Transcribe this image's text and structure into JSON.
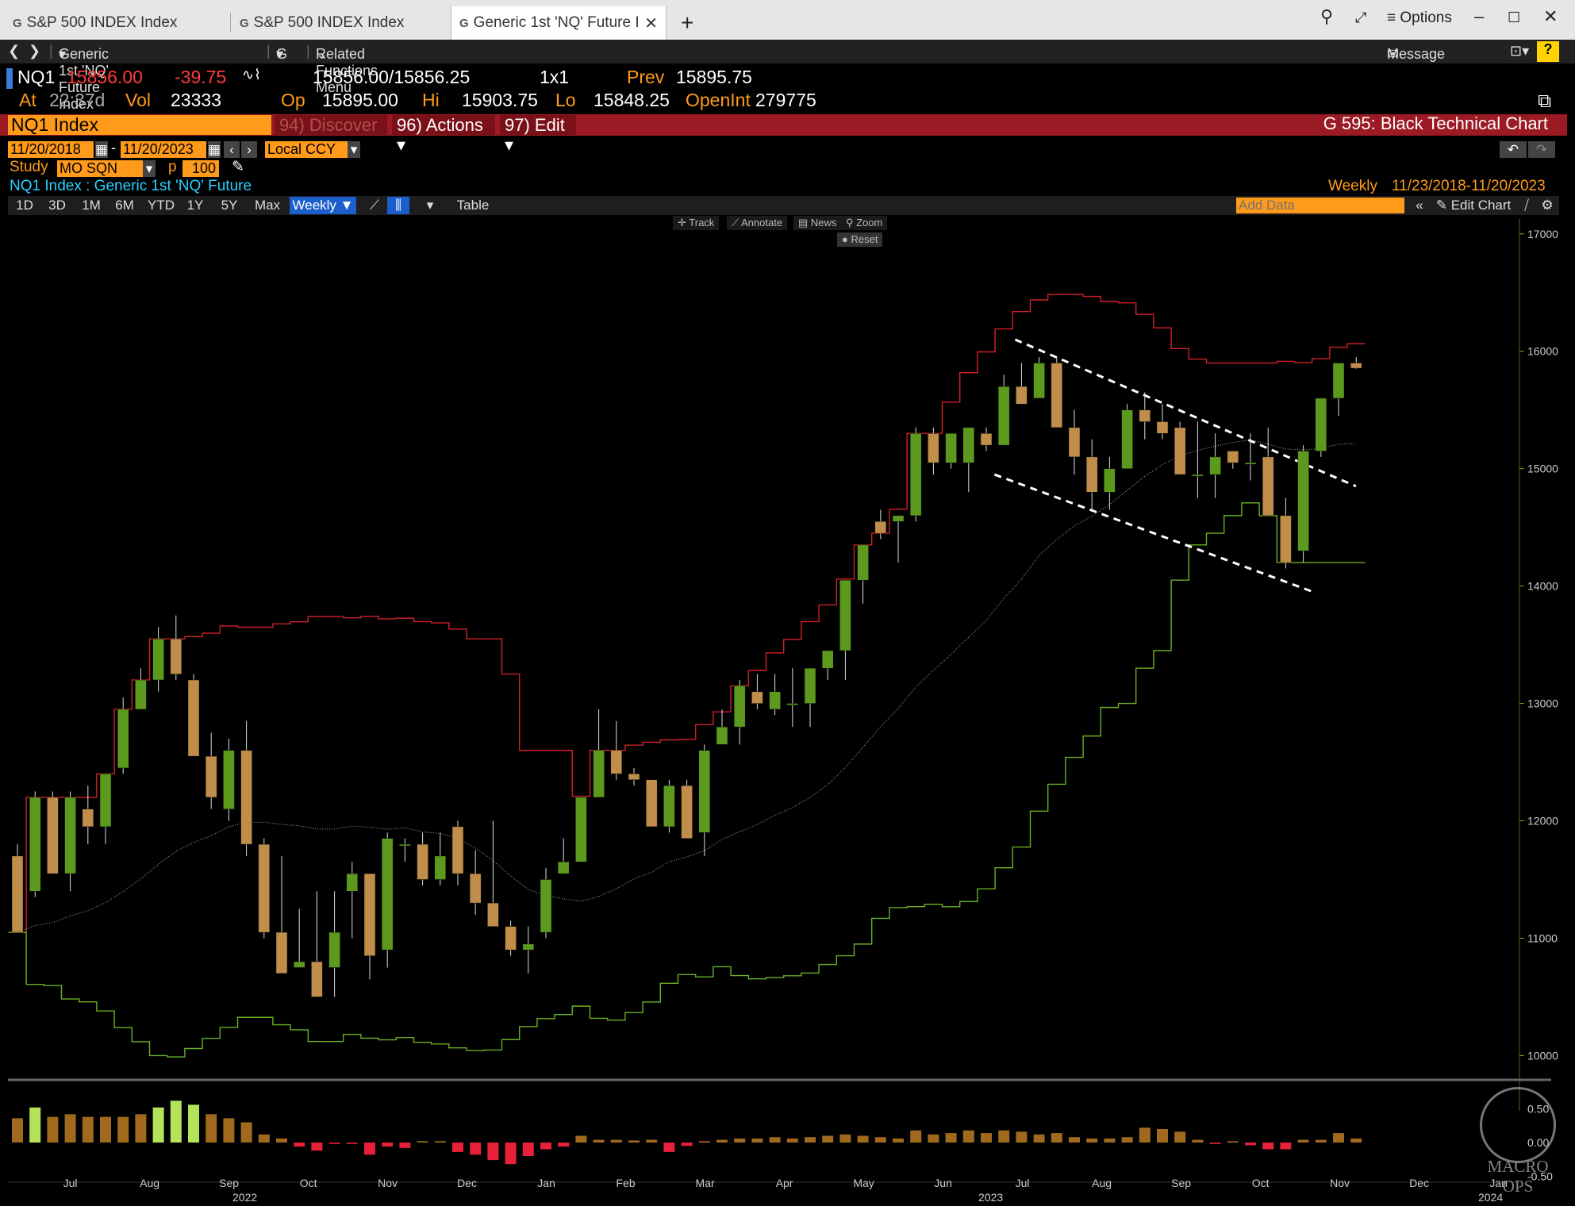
{
  "tabs": [
    {
      "icon": "G",
      "label": "S&P 500 INDEX Index"
    },
    {
      "icon": "G",
      "label": "S&P 500 INDEX Index"
    },
    {
      "icon": "G",
      "label": "Generic 1st 'NQ' Future Ind"
    }
  ],
  "window": {
    "options_label": "Options"
  },
  "nav": {
    "security_menu": "Generic 1st 'NQ' Future Index",
    "g_menu": "G",
    "related": "Related Functions Menu",
    "message": "Message",
    "help": "?"
  },
  "quote": {
    "ticker": "NQ1",
    "last": "15856.00",
    "change": "-39.75",
    "bidask": "15856.00/15856.25",
    "size": "1x1",
    "prev_label": "Prev",
    "prev": "15895.75",
    "at_label": "At",
    "time": "22:37d",
    "vol_label": "Vol",
    "vol": "23333",
    "op_label": "Op",
    "open": "15895.00",
    "hi_label": "Hi",
    "high": "15903.75",
    "lo_label": "Lo",
    "low": "15848.25",
    "oi_label": "OpenInt",
    "open_interest": "279775"
  },
  "command": {
    "security": "NQ1 Index",
    "discover": "94) Discover",
    "actions": "96) Actions",
    "edit": "97) Edit",
    "function_title": "G 595: Black Technical Chart"
  },
  "controls": {
    "start_date": "11/20/2018",
    "end_date": "11/20/2023",
    "dash": "-",
    "currency": "Local CCY",
    "study_label": "Study",
    "study": "MO SQN",
    "p_label": "p",
    "p_value": "100",
    "security_desc": "NQ1 Index : Generic 1st 'NQ' Future",
    "period": "Weekly",
    "range": "11/23/2018-11/20/2023",
    "add_data_placeholder": "Add Data",
    "edit_chart": "Edit Chart"
  },
  "timeframes": [
    "1D",
    "3D",
    "1M",
    "6M",
    "YTD",
    "1Y",
    "5Y",
    "Max"
  ],
  "selected_timeframe": "Weekly",
  "table_label": "Table",
  "chart_tools": [
    "Track",
    "Annotate",
    "News",
    "Zoom"
  ],
  "reset_label": "Reset",
  "watermark": "MACRO OPS",
  "colors": {
    "up": "#5b9a1c",
    "down": "#c08d4a",
    "upper_band": "#d0202a",
    "lower_band": "#6ab023",
    "hist_pos": "#a0691e",
    "hist_neg": "#e8203a",
    "hist_hi": "#b4e35a",
    "accent": "#ff9a1a"
  },
  "chart_data": {
    "type": "candlestick",
    "period": "weekly",
    "ylim": [
      9800,
      17100
    ],
    "yticks": [
      10000,
      11000,
      12000,
      13000,
      14000,
      15000,
      16000,
      17000
    ],
    "x_month_labels": [
      "Jul",
      "Aug",
      "Sep",
      "Oct",
      "Nov",
      "Dec",
      "Jan",
      "Feb",
      "Mar",
      "Apr",
      "May",
      "Jun",
      "Jul",
      "Aug",
      "Sep",
      "Oct",
      "Nov",
      "Dec",
      "Jan"
    ],
    "x_year_labels": [
      "2022",
      "2023",
      "2024"
    ],
    "candles": [
      {
        "o": 11700,
        "h": 11800,
        "l": 11050,
        "c": 11050
      },
      {
        "o": 11400,
        "h": 12250,
        "l": 11350,
        "c": 12200
      },
      {
        "o": 12200,
        "h": 12250,
        "l": 11550,
        "c": 11550
      },
      {
        "o": 11550,
        "h": 12250,
        "l": 11400,
        "c": 12200
      },
      {
        "o": 12100,
        "h": 12300,
        "l": 11800,
        "c": 11950
      },
      {
        "o": 11950,
        "h": 12400,
        "l": 11800,
        "c": 12400
      },
      {
        "o": 12450,
        "h": 13050,
        "l": 12400,
        "c": 12950
      },
      {
        "o": 12950,
        "h": 13300,
        "l": 12950,
        "c": 13200
      },
      {
        "o": 13200,
        "h": 13650,
        "l": 13100,
        "c": 13550
      },
      {
        "o": 13550,
        "h": 13750,
        "l": 13200,
        "c": 13250
      },
      {
        "o": 13200,
        "h": 13250,
        "l": 12550,
        "c": 12550
      },
      {
        "o": 12550,
        "h": 12750,
        "l": 12100,
        "c": 12200
      },
      {
        "o": 12100,
        "h": 12700,
        "l": 12000,
        "c": 12600
      },
      {
        "o": 12600,
        "h": 12850,
        "l": 11700,
        "c": 11800
      },
      {
        "o": 11800,
        "h": 11850,
        "l": 11000,
        "c": 11050
      },
      {
        "o": 11050,
        "h": 11700,
        "l": 10850,
        "c": 10700
      },
      {
        "o": 10750,
        "h": 11250,
        "l": 10800,
        "c": 10800
      },
      {
        "o": 10800,
        "h": 11400,
        "l": 10600,
        "c": 10500
      },
      {
        "o": 10750,
        "h": 11400,
        "l": 10500,
        "c": 11050
      },
      {
        "o": 11400,
        "h": 11650,
        "l": 11000,
        "c": 11550
      },
      {
        "o": 11550,
        "h": 11550,
        "l": 10650,
        "c": 10850
      },
      {
        "o": 10900,
        "h": 11900,
        "l": 10750,
        "c": 11850
      },
      {
        "o": 11800,
        "h": 11850,
        "l": 11650,
        "c": 11800
      },
      {
        "o": 11800,
        "h": 11900,
        "l": 11450,
        "c": 11500
      },
      {
        "o": 11500,
        "h": 11900,
        "l": 11450,
        "c": 11700
      },
      {
        "o": 11950,
        "h": 12000,
        "l": 11450,
        "c": 11550
      },
      {
        "o": 11550,
        "h": 11750,
        "l": 11200,
        "c": 11300
      },
      {
        "o": 11300,
        "h": 12000,
        "l": 11100,
        "c": 11100
      },
      {
        "o": 11100,
        "h": 11150,
        "l": 10850,
        "c": 10900
      },
      {
        "o": 10900,
        "h": 11100,
        "l": 10700,
        "c": 10950
      },
      {
        "o": 11050,
        "h": 11600,
        "l": 11000,
        "c": 11500
      },
      {
        "o": 11550,
        "h": 11850,
        "l": 11550,
        "c": 11650
      },
      {
        "o": 11650,
        "h": 12200,
        "l": 11650,
        "c": 12200
      },
      {
        "o": 12200,
        "h": 12950,
        "l": 12200,
        "c": 12600
      },
      {
        "o": 12600,
        "h": 12850,
        "l": 12350,
        "c": 12400
      },
      {
        "o": 12400,
        "h": 12450,
        "l": 12300,
        "c": 12350
      },
      {
        "o": 12350,
        "h": 12350,
        "l": 11950,
        "c": 11950
      },
      {
        "o": 11950,
        "h": 12350,
        "l": 11900,
        "c": 12300
      },
      {
        "o": 12300,
        "h": 12350,
        "l": 11900,
        "c": 11850
      },
      {
        "o": 11900,
        "h": 12650,
        "l": 11700,
        "c": 12600
      },
      {
        "o": 12650,
        "h": 12950,
        "l": 12650,
        "c": 12800
      },
      {
        "o": 12800,
        "h": 13200,
        "l": 12650,
        "c": 13150
      },
      {
        "o": 13100,
        "h": 13250,
        "l": 12950,
        "c": 13000
      },
      {
        "o": 12950,
        "h": 13250,
        "l": 12900,
        "c": 13100
      },
      {
        "o": 13000,
        "h": 13300,
        "l": 12800,
        "c": 13000
      },
      {
        "o": 13000,
        "h": 13300,
        "l": 12800,
        "c": 13300
      },
      {
        "o": 13300,
        "h": 13450,
        "l": 13200,
        "c": 13450
      },
      {
        "o": 13450,
        "h": 14050,
        "l": 13200,
        "c": 14050
      },
      {
        "o": 14050,
        "h": 14300,
        "l": 13850,
        "c": 14350
      },
      {
        "o": 14550,
        "h": 14650,
        "l": 14400,
        "c": 14450
      },
      {
        "o": 14550,
        "h": 14600,
        "l": 14200,
        "c": 14600
      },
      {
        "o": 14600,
        "h": 15350,
        "l": 14550,
        "c": 15300
      },
      {
        "o": 15300,
        "h": 15350,
        "l": 14950,
        "c": 15050
      },
      {
        "o": 15050,
        "h": 15250,
        "l": 15000,
        "c": 15300
      },
      {
        "o": 15050,
        "h": 15350,
        "l": 14800,
        "c": 15350
      },
      {
        "o": 15300,
        "h": 15350,
        "l": 15150,
        "c": 15200
      },
      {
        "o": 15200,
        "h": 15800,
        "l": 15200,
        "c": 15700
      },
      {
        "o": 15700,
        "h": 15900,
        "l": 15550,
        "c": 15550
      },
      {
        "o": 15600,
        "h": 15950,
        "l": 15600,
        "c": 15900
      },
      {
        "o": 15900,
        "h": 15950,
        "l": 15350,
        "c": 15350
      },
      {
        "o": 15350,
        "h": 15500,
        "l": 14950,
        "c": 15100
      },
      {
        "o": 15100,
        "h": 15250,
        "l": 14650,
        "c": 14800
      },
      {
        "o": 14800,
        "h": 15100,
        "l": 14650,
        "c": 15000
      },
      {
        "o": 15000,
        "h": 15550,
        "l": 15000,
        "c": 15500
      },
      {
        "o": 15500,
        "h": 15650,
        "l": 15250,
        "c": 15400
      },
      {
        "o": 15400,
        "h": 15550,
        "l": 15250,
        "c": 15300
      },
      {
        "o": 15350,
        "h": 15400,
        "l": 14950,
        "c": 14950
      },
      {
        "o": 14950,
        "h": 15400,
        "l": 14750,
        "c": 14950
      },
      {
        "o": 14950,
        "h": 15300,
        "l": 14750,
        "c": 15100
      },
      {
        "o": 15150,
        "h": 15150,
        "l": 15000,
        "c": 15050
      },
      {
        "o": 15050,
        "h": 15300,
        "l": 14900,
        "c": 15050
      },
      {
        "o": 15100,
        "h": 15350,
        "l": 14650,
        "c": 14600
      },
      {
        "o": 14600,
        "h": 14750,
        "l": 14150,
        "c": 14200
      },
      {
        "o": 14300,
        "h": 15200,
        "l": 14200,
        "c": 15150
      },
      {
        "o": 15150,
        "h": 15550,
        "l": 15100,
        "c": 15600
      },
      {
        "o": 15600,
        "h": 15900,
        "l": 15450,
        "c": 15900
      },
      {
        "o": 15900,
        "h": 15950,
        "l": 15850,
        "c": 15856
      }
    ],
    "histogram": [
      0.36,
      0.52,
      0.38,
      0.42,
      0.38,
      0.38,
      0.38,
      0.42,
      0.52,
      0.62,
      0.56,
      0.42,
      0.36,
      0.3,
      0.12,
      0.06,
      -0.06,
      -0.12,
      -0.02,
      -0.02,
      -0.18,
      -0.06,
      -0.08,
      0.02,
      0.02,
      -0.14,
      -0.18,
      -0.26,
      -0.32,
      -0.2,
      -0.1,
      -0.06,
      0.1,
      0.04,
      0.04,
      0.03,
      0.04,
      -0.14,
      -0.05,
      0.02,
      0.04,
      0.06,
      0.06,
      0.08,
      0.06,
      0.08,
      0.1,
      0.12,
      0.1,
      0.08,
      0.06,
      0.18,
      0.12,
      0.14,
      0.18,
      0.14,
      0.18,
      0.16,
      0.12,
      0.14,
      0.08,
      0.06,
      0.06,
      0.08,
      0.22,
      0.2,
      0.16,
      0.04,
      -0.02,
      0.02,
      -0.04,
      -0.1,
      -0.1,
      0.04,
      0.04,
      0.14,
      0.06
    ]
  }
}
